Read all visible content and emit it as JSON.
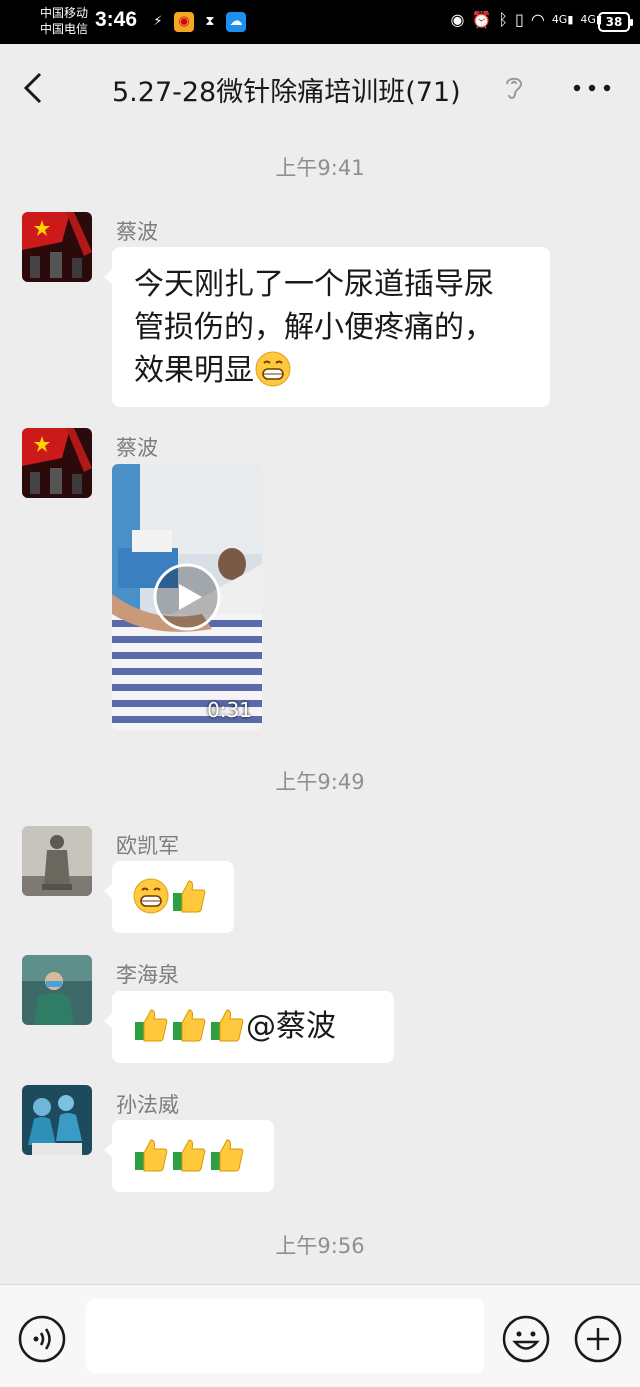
{
  "status_bar": {
    "carrier_1": "中国移动",
    "carrier_2": "中国电信",
    "time": "3:46",
    "battery": "38",
    "net_1": "4G",
    "net_2": "4G"
  },
  "nav": {
    "title": "5.27-28微针除痛培训班(71)"
  },
  "messages": [
    {
      "type": "timestamp",
      "text": "上午9:41"
    },
    {
      "type": "text",
      "sender": "蔡波",
      "line1": "今天刚扎了一个尿道插导尿",
      "line2": "管损伤的，解小便疼痛的，",
      "line3": "效果明显"
    },
    {
      "type": "video",
      "sender": "蔡波",
      "duration": "0:31"
    },
    {
      "type": "timestamp",
      "text": "上午9:49"
    },
    {
      "type": "emoji",
      "sender": "欧凯军"
    },
    {
      "type": "mention",
      "sender": "李海泉",
      "mention": "@蔡波"
    },
    {
      "type": "emoji",
      "sender": "孙法威"
    },
    {
      "type": "timestamp",
      "text": "上午9:56"
    }
  ],
  "colors": {
    "background": "#ededed",
    "bubble": "#ffffff",
    "timestamp": "#8f8f8f",
    "sender": "#7d7d7d"
  }
}
